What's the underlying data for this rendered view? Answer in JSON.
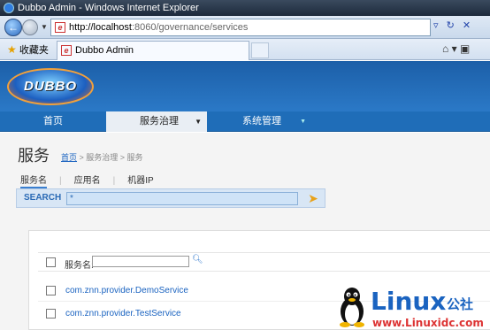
{
  "window": {
    "title": "Dubbo Admin - Windows Internet Explorer"
  },
  "browser": {
    "address_host": "http://localhost",
    "address_path": ":8060/governance/services",
    "favorites_label": "收藏夹",
    "tab_title": "Dubbo Admin"
  },
  "app": {
    "logo_text": "DUBBO",
    "menu": {
      "home": "首页",
      "governance": "服务治理",
      "system": "系统管理"
    }
  },
  "page": {
    "title": "服务",
    "breadcrumb": {
      "home": "首页",
      "rest": " > 服务治理 > 服务"
    },
    "subtabs": [
      "服务名",
      "应用名",
      "机器IP"
    ],
    "search": {
      "label": "SEARCH",
      "value": "*"
    },
    "table": {
      "column_label": "服务名:",
      "rows": [
        "com.znn.provider.DemoService",
        "com.znn.provider.TestService"
      ]
    }
  },
  "watermark": {
    "title": "Linux",
    "suffix": "公社",
    "url": "www.Linuxidc.com"
  },
  "colors": {
    "brand_blue": "#1f6db8",
    "link": "#1a63c0",
    "search_bg": "#d8e6f5"
  }
}
